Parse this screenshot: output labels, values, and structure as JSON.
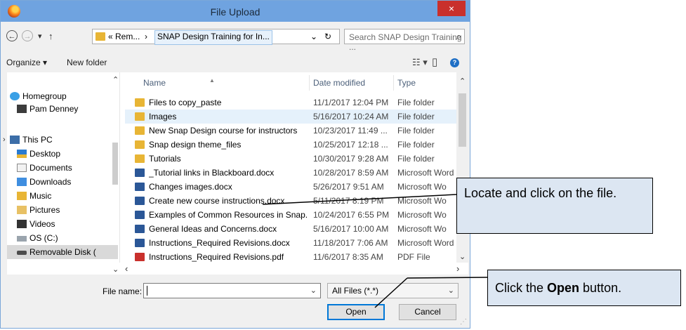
{
  "window": {
    "title": "File Upload",
    "close_glyph": "×"
  },
  "address": {
    "back_glyph": "←",
    "forward_glyph": "→",
    "recent_glyph": "▾",
    "up_glyph": "↑",
    "crumb_1": "« Rem...",
    "crumb_sep": "›",
    "crumb_current": "SNAP Design Training for In...",
    "dropdown_glyph": "⌄",
    "refresh_glyph": "↻",
    "search_placeholder": "Search SNAP Design Training ...",
    "search_glyph": "⌕"
  },
  "toolbar": {
    "organize": "Organize ▾",
    "new_folder": "New folder",
    "view_glyph": "☷ ▾",
    "pane_glyph": "▯",
    "help_glyph": "?"
  },
  "nav": {
    "items": [
      {
        "label": "Homegroup",
        "icon": "homegroup-icon"
      },
      {
        "label": "Pam Denney",
        "icon": "user-icon"
      },
      {
        "label": "This PC",
        "icon": "computer-icon"
      },
      {
        "label": "Desktop",
        "icon": "desktop-icon"
      },
      {
        "label": "Documents",
        "icon": "documents-icon"
      },
      {
        "label": "Downloads",
        "icon": "downloads-icon"
      },
      {
        "label": "Music",
        "icon": "music-icon"
      },
      {
        "label": "Pictures",
        "icon": "pictures-icon"
      },
      {
        "label": "Videos",
        "icon": "videos-icon"
      },
      {
        "label": "OS (C:)",
        "icon": "drive-icon"
      },
      {
        "label": "Removable Disk (",
        "icon": "removable-disk-icon"
      }
    ],
    "expand_glyph": "›"
  },
  "columns": {
    "name": "Name",
    "date": "Date modified",
    "type": "Type",
    "sort_glyph": "▲"
  },
  "files": [
    {
      "name": "Files to copy_paste",
      "date": "11/1/2017 12:04 PM",
      "type": "File folder",
      "kind": "folder"
    },
    {
      "name": "Images",
      "date": "5/16/2017 10:24 AM",
      "type": "File folder",
      "kind": "folder"
    },
    {
      "name": "New Snap Design course for instructors",
      "date": "10/23/2017 11:49 ...",
      "type": "File folder",
      "kind": "folder"
    },
    {
      "name": "Snap design theme_files",
      "date": "10/25/2017 12:18 ...",
      "type": "File folder",
      "kind": "folder"
    },
    {
      "name": "Tutorials",
      "date": "10/30/2017 9:28 AM",
      "type": "File folder",
      "kind": "folder"
    },
    {
      "name": "_Tutorial links in Blackboard.docx",
      "date": "10/28/2017 8:59 AM",
      "type": "Microsoft Word D",
      "kind": "word"
    },
    {
      "name": "Changes images.docx",
      "date": "5/26/2017 9:51 AM",
      "type": "Microsoft Wo",
      "kind": "word"
    },
    {
      "name": "Create new course instructions.docx",
      "date": "5/11/2017 8:19 PM",
      "type": "Microsoft Wo",
      "kind": "word"
    },
    {
      "name": "Examples of Common Resources in Snap...",
      "date": "10/24/2017 6:55 PM",
      "type": "Microsoft Wo",
      "kind": "word"
    },
    {
      "name": "General Ideas and Concerns.docx",
      "date": "5/16/2017 10:00 AM",
      "type": "Microsoft Wo",
      "kind": "word"
    },
    {
      "name": "Instructions_Required Revisions.docx",
      "date": "11/18/2017 7:06 AM",
      "type": "Microsoft Word D",
      "kind": "word"
    },
    {
      "name": "Instructions_Required Revisions.pdf",
      "date": "11/6/2017 8:35 AM",
      "type": "PDF File",
      "kind": "pdf"
    }
  ],
  "scroll": {
    "up": "⌃",
    "down": "⌄",
    "left": "‹",
    "right": "›"
  },
  "bottom": {
    "file_name_label": "File name:",
    "file_name_value": "",
    "dropdown_glyph": "⌄",
    "filter_value": "All Files (*.*)",
    "open_label": "Open",
    "cancel_label": "Cancel",
    "grip_glyph": "⋰"
  },
  "callouts": {
    "locate_text": "Locate and click on the file.",
    "open_prefix": "Click the ",
    "open_bold": "Open",
    "open_suffix": " button."
  },
  "colors": {
    "titlebar": "#6fa3e0",
    "close": "#c9302c",
    "callout_fill": "#dce6f2",
    "selected_row": "#e5f1fb"
  }
}
